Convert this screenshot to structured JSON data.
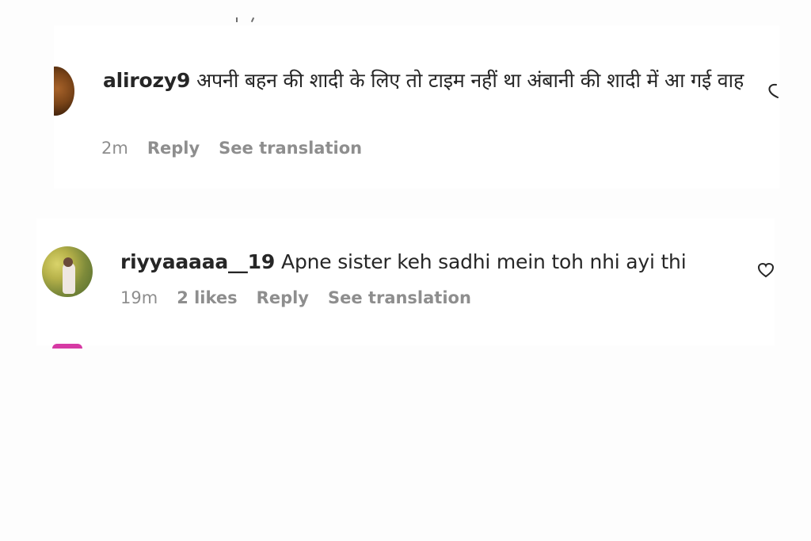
{
  "comments": [
    {
      "username": "alirozy9",
      "text": "अपनी बहन की शादी के लिए तो टाइम नहीं था अंबानी की शादी में आ गई वाह",
      "time": "2m",
      "likes": "",
      "reply_label": "Reply",
      "translate_label": "See translation",
      "avatar_icon": "avatar-photo-brown"
    },
    {
      "username": "riyyaaaaa__19",
      "text": "Apne sister keh sadhi mein toh nhi ayi thi",
      "time": "19m",
      "likes": "2 likes",
      "reply_label": "Reply",
      "translate_label": "See translation",
      "avatar_icon": "avatar-photo-garden"
    }
  ],
  "icons": {
    "like": "heart-outline-icon"
  },
  "colors": {
    "text_primary": "#262626",
    "text_secondary": "#8e8e8e",
    "next_avatar_ring": "#d63aa4"
  }
}
